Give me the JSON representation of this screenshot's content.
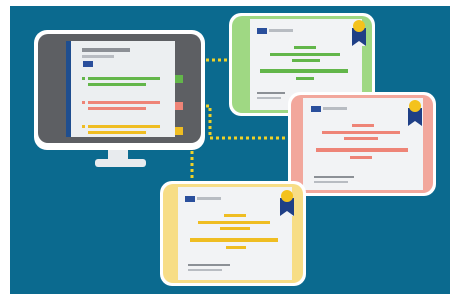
{
  "colors": {
    "background": "#0b6a8f",
    "frame": "#ffffff",
    "monitor_bezel": "#5d5f63",
    "monitor_screen": "#eceff1",
    "monitor_stand": "#e8ebee",
    "sidebar": "#1f4e8f",
    "eu_flag": "#2a4f9c",
    "eu_star": "#f4d21f",
    "text_line": "#b8bcc2",
    "text_line_dark": "#8c9096",
    "green_accent": "#63b64a",
    "green_border": "#9fd883",
    "red_accent": "#ee8477",
    "red_border": "#f2a79c",
    "yellow_accent": "#efbd22",
    "yellow_border": "#f7dd86",
    "connector": "#f0d227",
    "badge_ribbon": "#1f3f86",
    "badge_medal": "#f4c21d",
    "card_paper": "#f2f3f5"
  },
  "icons": {
    "eu_flag": "eu-flag-icon",
    "badge": "award-ribbon-icon",
    "monitor": "monitor-icon"
  }
}
